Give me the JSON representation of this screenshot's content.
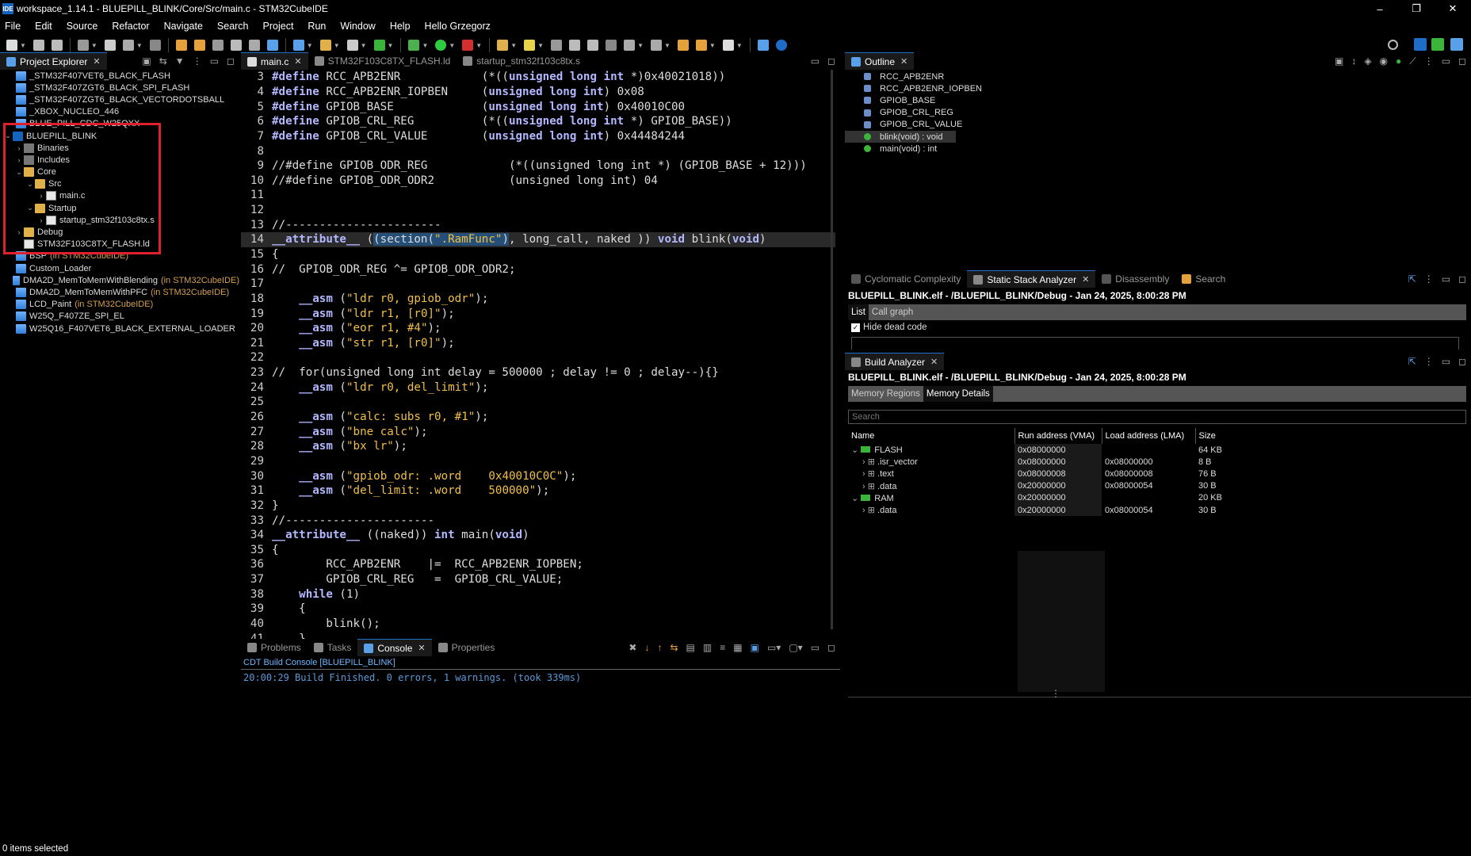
{
  "window": {
    "title": "workspace_1.14.1 - BLUEPILL_BLINK/Core/Src/main.c - STM32CubeIDE",
    "app_icon": "IDE",
    "minimize": "–",
    "restore": "❐",
    "close": "✕"
  },
  "menu": [
    "File",
    "Edit",
    "Source",
    "Refactor",
    "Navigate",
    "Search",
    "Project",
    "Run",
    "Window",
    "Help",
    "Hello Grzegorz"
  ],
  "explorer": {
    "tab": "Project Explorer",
    "items": [
      {
        "label": "_STM32F407VET6_BLACK_FLASH",
        "suffix": ""
      },
      {
        "label": "_STM32F407ZGT6_BLACK_SPI_FLASH",
        "suffix": ""
      },
      {
        "label": "_STM32F407ZGT6_BLACK_VECTORDOTSBALL",
        "suffix": ""
      },
      {
        "label": "_XBOX_NUCLEO_446",
        "suffix": ""
      },
      {
        "label": "BLUE_PILL_CDC_W25QXX",
        "suffix": ""
      },
      {
        "label": "BLUEPILL_BLINK",
        "suffix": ""
      },
      {
        "label": "Binaries",
        "suffix": ""
      },
      {
        "label": "Includes",
        "suffix": ""
      },
      {
        "label": "Core",
        "suffix": ""
      },
      {
        "label": "Src",
        "suffix": ""
      },
      {
        "label": "main.c",
        "suffix": ""
      },
      {
        "label": "Startup",
        "suffix": ""
      },
      {
        "label": "startup_stm32f103c8tx.s",
        "suffix": ""
      },
      {
        "label": "Debug",
        "suffix": ""
      },
      {
        "label": "STM32F103C8TX_FLASH.ld",
        "suffix": ""
      },
      {
        "label": "BSP",
        "suffix": "(in STM32CubeIDE)"
      },
      {
        "label": "Custom_Loader",
        "suffix": ""
      },
      {
        "label": "DMA2D_MemToMemWithBlending",
        "suffix": "(in STM32CubeIDE)"
      },
      {
        "label": "DMA2D_MemToMemWithPFC",
        "suffix": "(in STM32CubeIDE)"
      },
      {
        "label": "LCD_Paint",
        "suffix": "(in STM32CubeIDE)"
      },
      {
        "label": "W25Q_F407ZE_SPI_EL",
        "suffix": ""
      },
      {
        "label": "W25Q16_F407VET6_BLACK_EXTERNAL_LOADER",
        "suffix": ""
      }
    ]
  },
  "editor": {
    "tabs": [
      "main.c",
      "STM32F103C8TX_FLASH.ld",
      "startup_stm32f103c8tx.s"
    ],
    "line_numbers": [
      "3",
      "4",
      "5",
      "6",
      "7",
      "8",
      "9",
      "10",
      "11",
      "12",
      "13",
      "14",
      "15",
      "16",
      "17",
      "18",
      "19",
      "20",
      "21",
      "22",
      "23",
      "24",
      "25",
      "26",
      "27",
      "28",
      "29",
      "30",
      "31",
      "32",
      "33",
      "34",
      "35",
      "36",
      "37",
      "38",
      "39",
      "40",
      "41"
    ]
  },
  "console": {
    "tabs": [
      "Problems",
      "Tasks",
      "Console",
      "Properties"
    ],
    "subtitle": "CDT Build Console [BLUEPILL_BLINK]",
    "output": "20:00:29 Build Finished. 0 errors, 1 warnings. (took 339ms)"
  },
  "outline": {
    "tab": "Outline",
    "items": [
      "RCC_APB2ENR",
      "RCC_APB2ENR_IOPBEN",
      "GPIOB_BASE",
      "GPIOB_CRL_REG",
      "GPIOB_CRL_VALUE",
      "blink(void) : void",
      "main(void) : int"
    ]
  },
  "stack": {
    "tabs": [
      "Cyclomatic Complexity",
      "Static Stack Analyzer",
      "Disassembly",
      "Search"
    ],
    "header": "BLUEPILL_BLINK.elf - /BLUEPILL_BLINK/Debug - Jan 24, 2025, 8:00:28 PM",
    "subtabs": [
      "List",
      "Call graph"
    ],
    "hide_dead_code": "Hide dead code"
  },
  "build": {
    "tab": "Build Analyzer",
    "header": "BLUEPILL_BLINK.elf - /BLUEPILL_BLINK/Debug - Jan 24, 2025, 8:00:28 PM",
    "subtabs": [
      "Memory Regions",
      "Memory Details"
    ],
    "search_placeholder": "Search",
    "columns": [
      "Name",
      "Run address (VMA)",
      "Load address (LMA)",
      "Size"
    ],
    "rows": [
      {
        "name": "FLASH",
        "vma": "0x08000000",
        "lma": "",
        "size": "64 KB",
        "level": 0
      },
      {
        "name": ".isr_vector",
        "vma": "0x08000000",
        "lma": "0x08000000",
        "size": "8 B",
        "level": 1
      },
      {
        "name": ".text",
        "vma": "0x08000008",
        "lma": "0x08000008",
        "size": "76 B",
        "level": 1
      },
      {
        "name": ".data",
        "vma": "0x20000000",
        "lma": "0x08000054",
        "size": "30 B",
        "level": 1
      },
      {
        "name": "RAM",
        "vma": "0x20000000",
        "lma": "",
        "size": "20 KB",
        "level": 0
      },
      {
        "name": ".data",
        "vma": "0x20000000",
        "lma": "0x08000054",
        "size": "30 B",
        "level": 1
      }
    ]
  },
  "status": {
    "text": "0 items selected"
  }
}
